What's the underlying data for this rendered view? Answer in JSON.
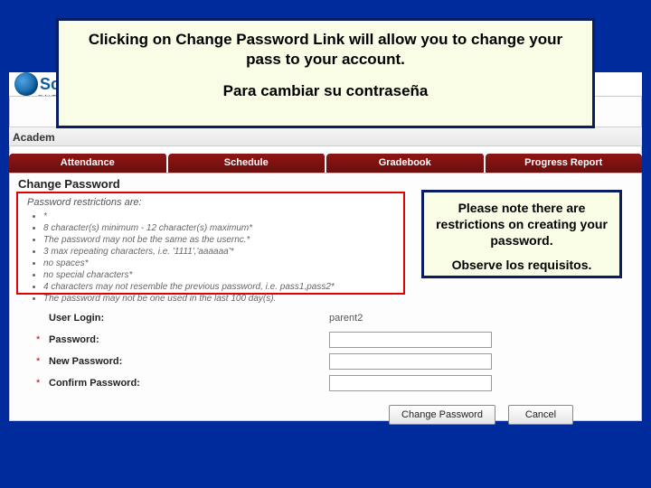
{
  "logo": {
    "text": "Sch",
    "sub": "ENT"
  },
  "academics_bar": "Academ",
  "tabs": [
    "Attendance",
    "Schedule",
    "Gradebook",
    "Progress Report"
  ],
  "section_title": "Change Password",
  "restrictions": {
    "caption": "Password restrictions are:",
    "items": [
      "*",
      "8 character(s) minimum - 12 character(s) maximum*",
      "The password may not be the same as the usernc.*",
      "3 max repeating characters, i.e. '1111','aaaaaa'*",
      "no spaces*",
      "no special characters*",
      "4 characters may not resemble the previous password, i.e. pass1,pass2*",
      "The password may not be one used in the last 100 day(s)."
    ]
  },
  "form": {
    "user_login_label": "User Login:",
    "user_login_value": "parent2",
    "password_label": "Password:",
    "new_password_label": "New Password:",
    "confirm_password_label": "Confirm Password:"
  },
  "buttons": {
    "change": "Change Password",
    "cancel": "Cancel"
  },
  "callout_top": {
    "line1": "Clicking on Change Password Link will allow you to change your pass to your account.",
    "line2": "Para cambiar su contraseña"
  },
  "callout_right": {
    "line1": "Please note there are restrictions on creating your password.",
    "line2": "Observe los requisitos."
  }
}
